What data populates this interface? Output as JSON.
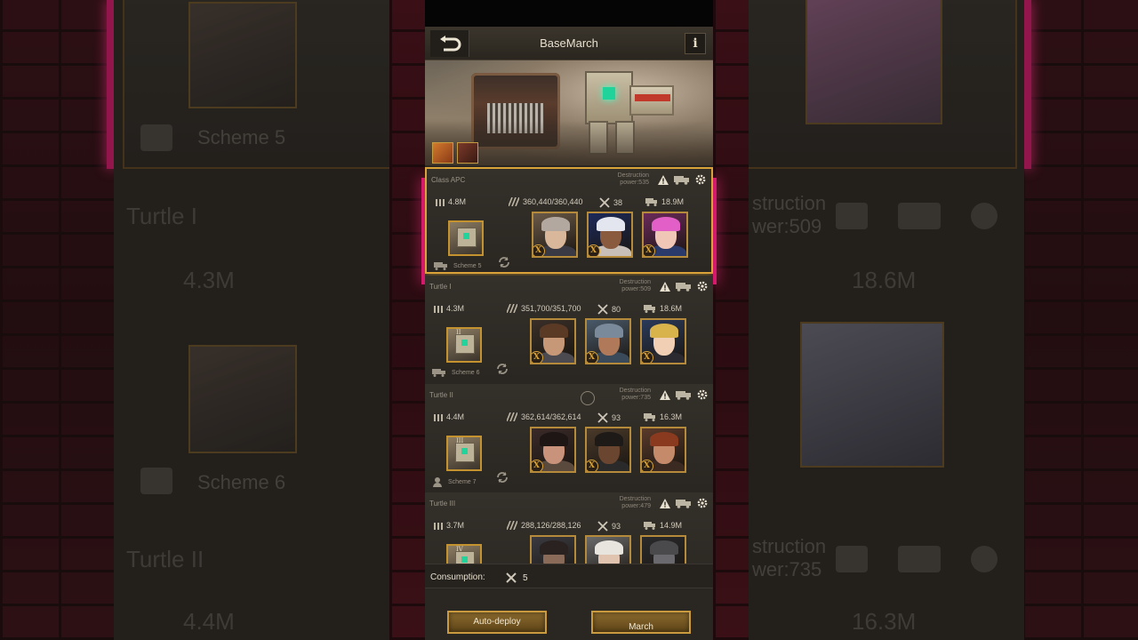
{
  "header": {
    "title": "BaseMarch",
    "info_label": "i"
  },
  "teams": [
    {
      "name": "Class APC",
      "destruction_label": "Destruction",
      "destruction_power": "power:535",
      "ammo": "4.8M",
      "hp": "360,440/360,440",
      "repair": "38",
      "load": "18.9M",
      "scheme": "Scheme 5",
      "vehicle_mark": "",
      "selected": true,
      "heroes": [
        "hero-male-silver-hair",
        "hero-female-blue-hat",
        "hero-female-pink-hair"
      ]
    },
    {
      "name": "Turtle I",
      "destruction_label": "Destruction",
      "destruction_power": "power:509",
      "ammo": "4.3M",
      "hp": "351,700/351,700",
      "repair": "80",
      "load": "18.6M",
      "scheme": "Scheme 6",
      "vehicle_mark": "II",
      "selected": false,
      "heroes": [
        "hero-male-brown-hair",
        "hero-female-helmet",
        "hero-female-headset"
      ]
    },
    {
      "name": "Turtle II",
      "destruction_label": "Destruction",
      "destruction_power": "power:735",
      "ammo": "4.4M",
      "hp": "362,614/362,614",
      "repair": "93",
      "load": "16.3M",
      "scheme": "Scheme 7",
      "vehicle_mark": "III",
      "selected": false,
      "heroes": [
        "hero-female-dark-hair",
        "hero-male-goggles",
        "hero-male-bearded"
      ]
    },
    {
      "name": "Turtle III",
      "destruction_label": "Destruction",
      "destruction_power": "power:479",
      "ammo": "3.7M",
      "hp": "288,126/288,126",
      "repair": "93",
      "load": "14.9M",
      "scheme": "",
      "vehicle_mark": "IV",
      "selected": false,
      "heroes": [
        "hero-male-dark",
        "hero-female-white-hair",
        "hero-gas-mask"
      ]
    }
  ],
  "consumption": {
    "label": "Consumption:",
    "value": "5"
  },
  "buttons": {
    "auto_deploy": "Auto-deploy",
    "march": "March"
  },
  "background_zoom": {
    "scheme_a": "Scheme 5",
    "scheme_b": "Scheme 6",
    "turtle_i": "Turtle I",
    "turtle_ii": "Turtle II",
    "ammo_a": "4.3M",
    "ammo_b": "4.4M",
    "load_a": "18.6M",
    "load_b": "16.3M",
    "dp_a_1": "struction",
    "dp_a_2": "wer:509",
    "dp_b_1": "struction",
    "dp_b_2": "wer:735"
  },
  "colors": {
    "accent_gold": "#d9a33a",
    "wall_red": "#3a0f16",
    "neon_pink": "#d61a6b"
  }
}
